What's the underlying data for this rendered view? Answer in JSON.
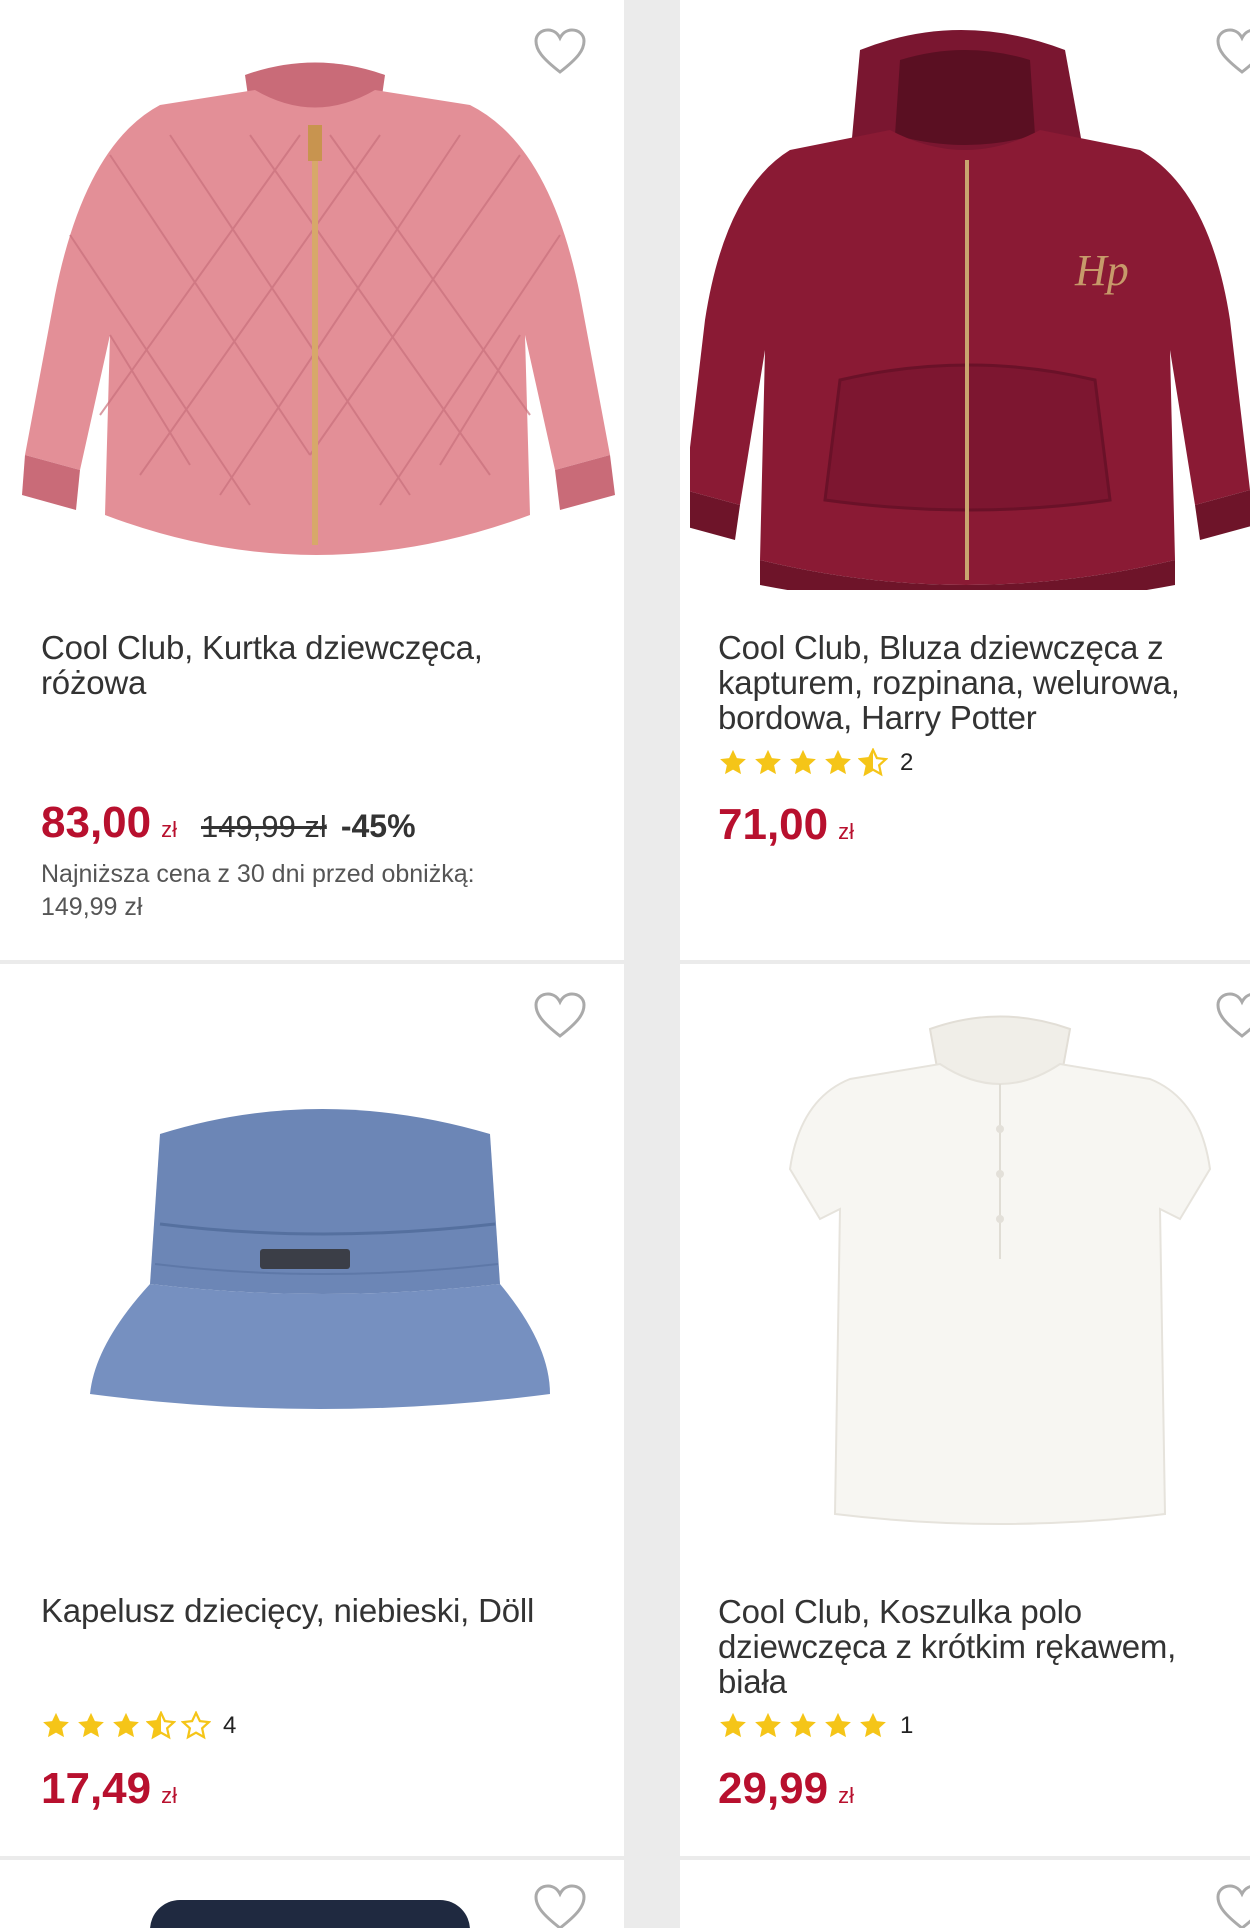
{
  "colors": {
    "price": "#b8102e",
    "star": "#f5c518",
    "background": "#ebebeb",
    "card": "#ffffff"
  },
  "products": [
    {
      "title": "Cool Club, Kurtka dziewczęca, różowa",
      "title_lines": [
        "Cool Club, Kurtka dziewczęca,",
        "różowa"
      ],
      "price": "83,00",
      "currency": "zł",
      "old_price": "149,99 zł",
      "discount": "-45%",
      "lowest_price_label": "Najniższa cena z 30 dni przed obniżką:",
      "lowest_price_value": "149,99 zł",
      "image": "pink-quilted-jacket",
      "favorite_icon": "heart-outline-icon"
    },
    {
      "title": "Cool Club, Bluza dziewczęca z kapturem, rozpinana, welurowa, bordowa, Harry Potter",
      "title_lines": [
        "Cool Club, Bluza dziewczęca z",
        "kapturem, rozpinana, welurowa,",
        "bordowa, Harry Potter"
      ],
      "rating": 4.5,
      "rating_count": "2",
      "price": "71,00",
      "currency": "zł",
      "image": "burgundy-velour-hoodie",
      "favorite_icon": "heart-outline-icon"
    },
    {
      "title": "Kapelusz dziecięcy, niebieski, Döll",
      "title_lines": [
        "Kapelusz dziecięcy, niebieski, Döll"
      ],
      "rating": 3.5,
      "rating_count": "4",
      "price": "17,49",
      "currency": "zł",
      "image": "blue-denim-bucket-hat",
      "favorite_icon": "heart-outline-icon"
    },
    {
      "title": "Cool Club, Koszulka polo dziewczęca z krótkim rękawem, biała",
      "title_lines": [
        "Cool Club, Koszulka polo",
        "dziewczęca z krótkim rękawem,",
        "biała"
      ],
      "rating": 5,
      "rating_count": "1",
      "price": "29,99",
      "currency": "zł",
      "image": "white-polo-shirt",
      "favorite_icon": "heart-outline-icon"
    }
  ]
}
